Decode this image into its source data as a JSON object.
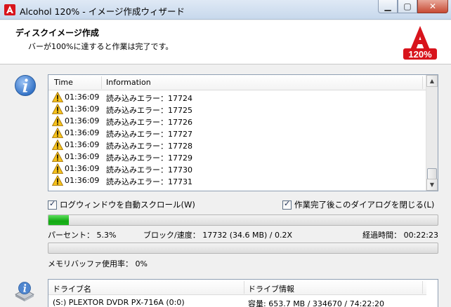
{
  "window": {
    "title": "Alcohol 120% - イメージ作成ウィザード",
    "icon": "alcohol-app-icon",
    "controls": [
      "minimize-icon",
      "maximize-icon",
      "close-icon"
    ]
  },
  "header": {
    "title": "ディスクイメージ作成",
    "subtitle": "バーが100%に達すると作業は完了です。",
    "logo_text": "120%",
    "logo_color": "#d8141c"
  },
  "log": {
    "columns": [
      "Time",
      "Information"
    ],
    "rows": [
      {
        "icon": "warning-icon",
        "time": "01:36:09",
        "info": "読み込みエラー：17724"
      },
      {
        "icon": "warning-icon",
        "time": "01:36:09",
        "info": "読み込みエラー：17725"
      },
      {
        "icon": "warning-icon",
        "time": "01:36:09",
        "info": "読み込みエラー：17726"
      },
      {
        "icon": "warning-icon",
        "time": "01:36:09",
        "info": "読み込みエラー：17727"
      },
      {
        "icon": "warning-icon",
        "time": "01:36:09",
        "info": "読み込みエラー：17728"
      },
      {
        "icon": "warning-icon",
        "time": "01:36:09",
        "info": "読み込みエラー：17729"
      },
      {
        "icon": "warning-icon",
        "time": "01:36:09",
        "info": "読み込みエラー：17730"
      },
      {
        "icon": "warning-icon",
        "time": "01:36:09",
        "info": "読み込みエラー：17731"
      }
    ]
  },
  "options": {
    "autoscroll_label": "ログウィンドウを自動スクロール(W)",
    "autoscroll_checked": true,
    "close_dialog_label": "作業完了後このダイアログを閉じる(L)",
    "close_dialog_checked": true
  },
  "progress": {
    "percent_fraction": 0.053,
    "percent_label": "パーセント：  5.3%",
    "block_label": "ブロック/速度：  17732 (34.6 MB) / 0.2X",
    "elapsed_label": "経過時間：  00:22:23"
  },
  "buffer": {
    "fraction": 0.0,
    "label": "メモリバッファ使用率：  0%"
  },
  "drive": {
    "columns": [
      "ドライブ名",
      "ドライブ情報"
    ],
    "name": "(S:) PLEXTOR DVDR    PX-716A (0:0)",
    "info": "容量: 653.7 MB / 334670 / 74:22:20"
  }
}
